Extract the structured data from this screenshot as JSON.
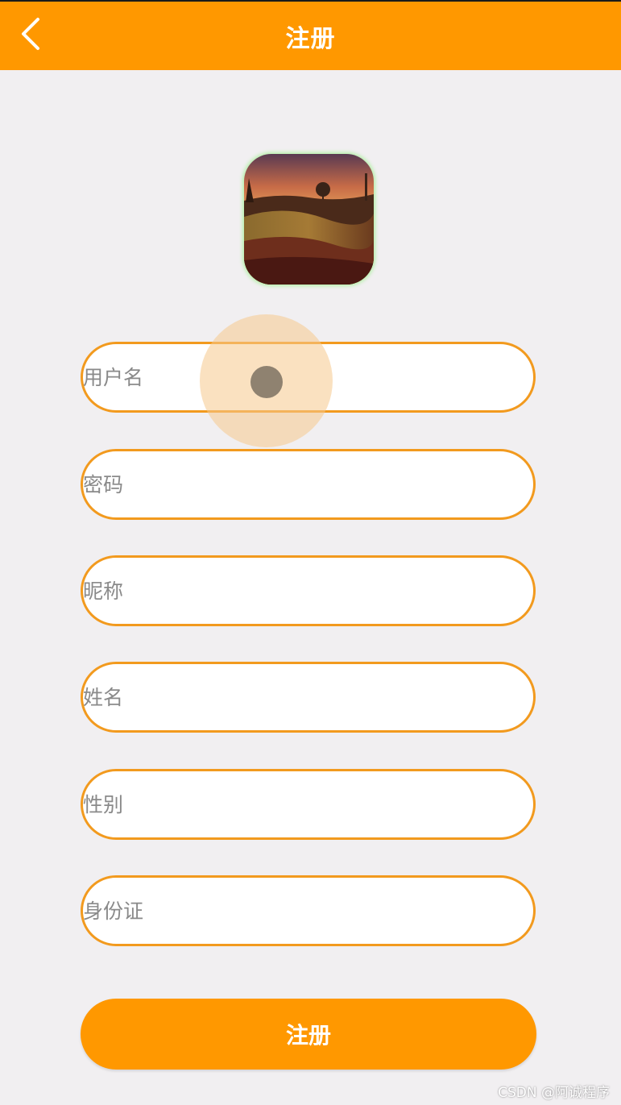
{
  "header": {
    "title": "注册",
    "back_icon": "chevron-left-icon"
  },
  "avatar": {
    "icon": "landscape-avatar-image"
  },
  "form": {
    "username_placeholder": "用户名",
    "password_placeholder": "密码",
    "nickname_placeholder": "昵称",
    "name_placeholder": "姓名",
    "gender_placeholder": "性别",
    "id_card_placeholder": "身份证"
  },
  "actions": {
    "register_label": "注册"
  },
  "watermark": "CSDN @阿诚程序",
  "colors": {
    "accent": "#ff9800",
    "field_border": "#f29a1e",
    "background": "#f1eff1"
  }
}
